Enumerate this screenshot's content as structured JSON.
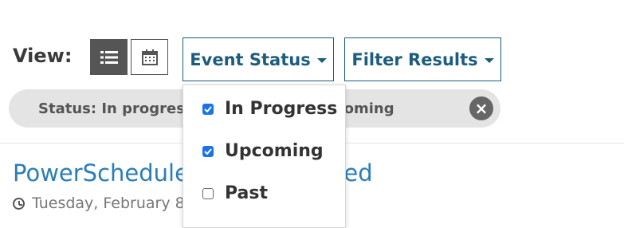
{
  "view": {
    "label": "View:",
    "list_icon": "list-icon",
    "calendar_icon": "calendar-icon"
  },
  "dropdowns": {
    "event_status": "Event Status",
    "filter_results": "Filter Results"
  },
  "chips": {
    "left_text": "Status: In progress",
    "right_text": ": Upcoming",
    "close_icon": "close-icon"
  },
  "event": {
    "title_left": "PowerSchedule",
    "title_right": "ted",
    "date": "Tuesday, February 8,"
  },
  "status_menu": {
    "items": [
      {
        "label": "In Progress",
        "checked": true
      },
      {
        "label": "Upcoming",
        "checked": true
      },
      {
        "label": "Past",
        "checked": false
      }
    ]
  },
  "colors": {
    "accent": "#1c5d7d",
    "link": "#2a7db8",
    "checkbox": "#1b73e8"
  }
}
